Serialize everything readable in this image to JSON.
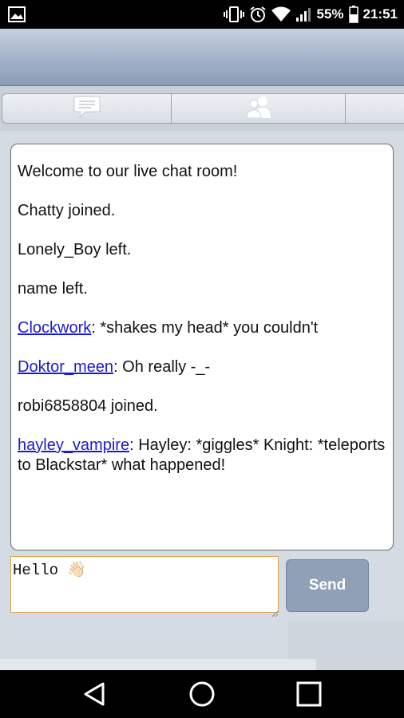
{
  "status_bar": {
    "battery": "55%",
    "time": "21:51",
    "icons": [
      "gallery-icon",
      "vibrate-icon",
      "alarm-icon",
      "wifi-icon",
      "signal-icon",
      "battery-icon"
    ]
  },
  "tabs": [
    {
      "name": "chat",
      "icon": "chat-bubble-icon"
    },
    {
      "name": "users",
      "icon": "users-icon"
    },
    {
      "name": "more",
      "icon": ""
    }
  ],
  "messages": [
    {
      "user": "",
      "text": "Welcome to our live chat room!"
    },
    {
      "user": "",
      "text": "Chatty joined."
    },
    {
      "user": "",
      "text": "Lonely_Boy left."
    },
    {
      "user": "",
      "text": "name left."
    },
    {
      "user": "Clockwork",
      "text": ": *shakes my head* you couldn't"
    },
    {
      "user": "Doktor_meen",
      "text": ": Oh really -_-"
    },
    {
      "user": "",
      "text": "robi6858804 joined."
    },
    {
      "user": "hayley_vampire",
      "text": ": Hayley: *giggles* Knight: *teleports to Blackstar* what happened!"
    }
  ],
  "composer": {
    "value": "Hello 👋🏻",
    "send_label": "Send"
  },
  "nav": [
    "back-icon",
    "home-icon",
    "recents-icon"
  ],
  "colors": {
    "link": "#1a1ad6",
    "send_button": "#8fa0b7",
    "input_border": "#e0a040"
  }
}
